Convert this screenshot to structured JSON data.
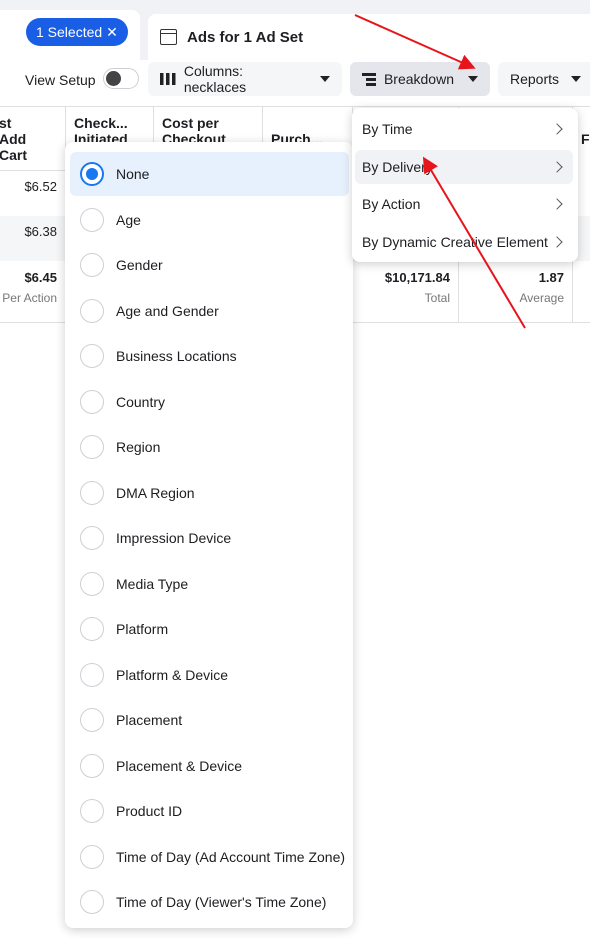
{
  "tabs": {
    "selected": "1 Selected",
    "close": "✕",
    "ads_tab": "Ads for 1 Ad Set"
  },
  "toolbar": {
    "view_setup": "View Setup",
    "columns": "Columns: necklaces",
    "breakdown": "Breakdown",
    "reports": "Reports"
  },
  "table": {
    "headers": [
      "st\nAdd\nCart",
      "Check...\nInitiated",
      "Cost per\nCheckout\nInitiated",
      "Purch...",
      "",
      "",
      "F"
    ],
    "rows": [
      [
        "$6.52"
      ],
      [
        "$6.38"
      ]
    ],
    "summary": [
      {
        "value": "$6.45",
        "label": "Per Action"
      },
      {
        "value": "$10,171.84",
        "label": "Total"
      },
      {
        "value": "1.87",
        "label": "Average"
      }
    ]
  },
  "breakdown_menu": {
    "items": [
      "By Time",
      "By Delivery",
      "By Action",
      "By Dynamic Creative Element"
    ],
    "highlighted": "By Delivery"
  },
  "delivery_options": {
    "selected": "None",
    "items": [
      "None",
      "Age",
      "Gender",
      "Age and Gender",
      "Business Locations",
      "Country",
      "Region",
      "DMA Region",
      "Impression Device",
      "Media Type",
      "Platform",
      "Platform & Device",
      "Placement",
      "Placement & Device",
      "Product ID",
      "Time of Day (Ad Account Time Zone)",
      "Time of Day (Viewer's Time Zone)"
    ]
  },
  "colors": {
    "accent": "#1877f2",
    "selected_pill": "#1a5ee6",
    "annotation_arrow": "#e8141b"
  }
}
